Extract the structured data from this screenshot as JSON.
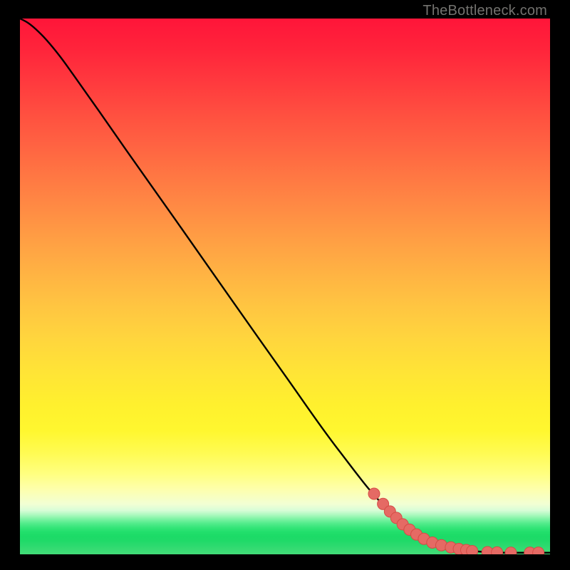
{
  "attribution": "TheBottleneck.com",
  "colors": {
    "background": "#000000",
    "curve": "#000000",
    "marker_fill": "#e56a64",
    "marker_stroke": "#d54b45",
    "attribution_text": "#73726f"
  },
  "gradient_stops": [
    {
      "pos": 0.0,
      "c": "#ff1539"
    },
    {
      "pos": 0.06,
      "c": "#ff253b"
    },
    {
      "pos": 0.12,
      "c": "#ff3a3e"
    },
    {
      "pos": 0.18,
      "c": "#ff5040"
    },
    {
      "pos": 0.24,
      "c": "#ff6442"
    },
    {
      "pos": 0.3,
      "c": "#ff7943"
    },
    {
      "pos": 0.36,
      "c": "#ff8d44"
    },
    {
      "pos": 0.42,
      "c": "#ffa144"
    },
    {
      "pos": 0.48,
      "c": "#ffb443"
    },
    {
      "pos": 0.54,
      "c": "#ffc641"
    },
    {
      "pos": 0.6,
      "c": "#ffd63d"
    },
    {
      "pos": 0.66,
      "c": "#ffe436"
    },
    {
      "pos": 0.72,
      "c": "#fff02e"
    },
    {
      "pos": 0.77,
      "c": "#fff72f"
    },
    {
      "pos": 0.81,
      "c": "#fffb52"
    },
    {
      "pos": 0.85,
      "c": "#ffff80"
    },
    {
      "pos": 0.88,
      "c": "#fdffaf"
    },
    {
      "pos": 0.906,
      "c": "#f2ffd4"
    },
    {
      "pos": 0.918,
      "c": "#d8fdd7"
    },
    {
      "pos": 0.926,
      "c": "#aef9c0"
    },
    {
      "pos": 0.934,
      "c": "#7ef3a4"
    },
    {
      "pos": 0.942,
      "c": "#54ec8c"
    },
    {
      "pos": 0.95,
      "c": "#35e579"
    },
    {
      "pos": 0.958,
      "c": "#22df6c"
    },
    {
      "pos": 0.966,
      "c": "#1cdb67"
    },
    {
      "pos": 0.974,
      "c": "#1fda68"
    },
    {
      "pos": 0.982,
      "c": "#29da6d"
    },
    {
      "pos": 0.99,
      "c": "#35db72"
    },
    {
      "pos": 1.0,
      "c": "#43dc78"
    }
  ],
  "chart_data": {
    "type": "line",
    "title": "",
    "xlabel": "",
    "ylabel": "",
    "xlim": [
      0,
      100
    ],
    "ylim": [
      0,
      100
    ],
    "series": [
      {
        "name": "curve",
        "kind": "line",
        "x": [
          0.0,
          1.5,
          3.0,
          5.0,
          7.5,
          10.0,
          15.0,
          20.0,
          30.0,
          40.0,
          50.0,
          60.0,
          70.0,
          80.0,
          85.0,
          88.0,
          90.0,
          92.0,
          95.0,
          100.0
        ],
        "y": [
          100.0,
          99.2,
          98.0,
          96.0,
          93.0,
          89.6,
          82.6,
          75.5,
          61.5,
          47.4,
          33.4,
          19.6,
          7.8,
          1.6,
          0.7,
          0.4,
          0.35,
          0.3,
          0.3,
          0.3
        ]
      },
      {
        "name": "markers",
        "kind": "scatter",
        "x": [
          66.8,
          68.5,
          69.8,
          71.0,
          72.2,
          73.5,
          74.8,
          76.2,
          77.8,
          79.5,
          81.3,
          82.8,
          84.2,
          85.3,
          88.2,
          90.0,
          92.6,
          96.2,
          97.8
        ],
        "y": [
          11.3,
          9.4,
          8.0,
          6.8,
          5.6,
          4.6,
          3.7,
          2.9,
          2.2,
          1.7,
          1.3,
          1.0,
          0.8,
          0.6,
          0.4,
          0.35,
          0.3,
          0.3,
          0.3
        ]
      }
    ]
  }
}
